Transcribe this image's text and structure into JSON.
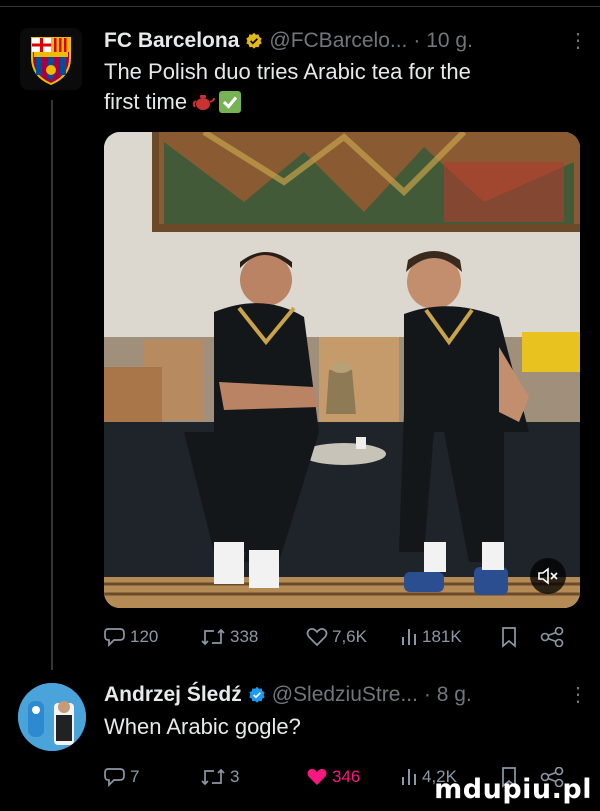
{
  "tweet1": {
    "name": "FC Barcelona",
    "handle": "@FCBarcelo...",
    "time": "· 10 g.",
    "text_line1": "The Polish duo tries Arabic tea for the",
    "text_line2": "first time",
    "stats": {
      "replies": "120",
      "retweets": "338",
      "likes": "7,6K",
      "views": "181K"
    }
  },
  "tweet2": {
    "name": "Andrzej Śledź",
    "handle": "@SledziuStre...",
    "time": "· 8 g.",
    "text": "When Arabic gogle?",
    "stats": {
      "replies": "7",
      "retweets": "3",
      "likes": "346",
      "views": "4,2K"
    }
  },
  "icons": {
    "verified": "gold-verified-badge",
    "reply": "comment-icon",
    "retweet": "retweet-icon",
    "like": "heart-icon",
    "views": "views-bar-icon",
    "bookmark": "bookmark-icon",
    "share": "share-icon",
    "mute": "mute-icon",
    "more": "more-dots-icon"
  },
  "colors": {
    "background": "#000000",
    "text": "#e7e9ea",
    "muted": "#71767b",
    "like_active": "#f91880",
    "verified_gold": "#e2b719",
    "verified_blue": "#1d9bf0"
  },
  "watermark": "mdupiu.pl"
}
